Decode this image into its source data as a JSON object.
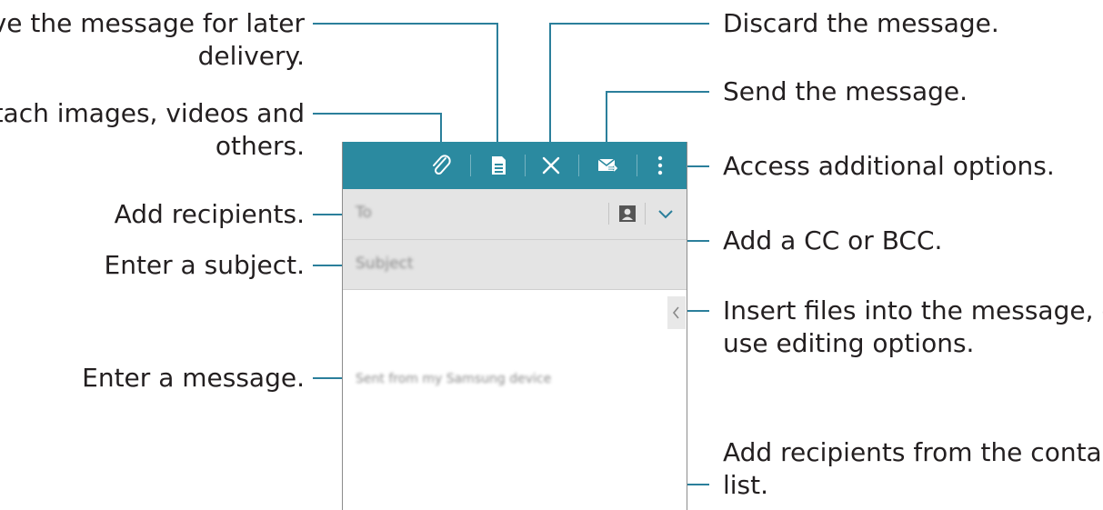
{
  "callouts": {
    "save_line1": "Save the message for later",
    "save_line2": "delivery.",
    "attach_line1": "Attach images, videos and",
    "attach_line2": "others.",
    "add_recipients": "Add recipients.",
    "enter_subject": "Enter a subject.",
    "enter_message": "Enter a message.",
    "discard": "Discard the message.",
    "send": "Send the message.",
    "more_options": "Access additional options.",
    "cc_bcc": "Add a CC or BCC.",
    "insert_line1": "Insert files into the message, or",
    "insert_line2": "use editing options.",
    "contacts_line1": "Add recipients from the contacts",
    "contacts_line2": "list."
  },
  "compose": {
    "to_placeholder": "To",
    "subject_placeholder": "Subject",
    "signature": "Sent from my Samsung device"
  },
  "icons": {
    "attach": "paperclip-icon",
    "save": "save-icon",
    "discard": "close-icon",
    "send": "send-mail-icon",
    "more": "more-vertical-icon",
    "contacts": "contact-card-icon",
    "expand": "chevron-down-icon",
    "panel": "chevron-left-icon"
  },
  "colors": {
    "action_bar": "#2b8aa0",
    "callout_line": "#2b7f9b",
    "field_bg": "#e4e4e4"
  }
}
